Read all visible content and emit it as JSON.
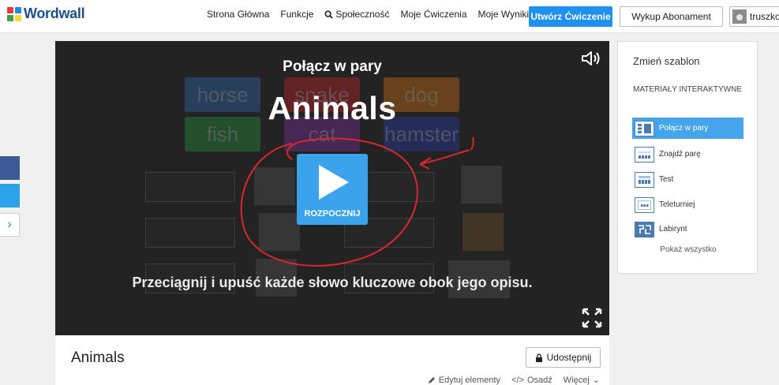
{
  "header": {
    "logo_text": "Wordwall",
    "nav": [
      "Strona Główna",
      "Funkcje",
      "Społeczność",
      "Moje Ćwiczenia",
      "Moje Wyniki"
    ],
    "create_button": "Utwórz Ćwiczenie",
    "subscribe_button": "Wykup Abonament",
    "username": "truszko"
  },
  "game": {
    "template_name": "Połącz w pary",
    "title": "Animals",
    "start_label": "ROZPOCZNIJ",
    "instructions": "Przeciągnij i upuść każde słowo kluczowe obok jego opisu.",
    "words": [
      {
        "text": "horse",
        "color": "#2f75c8"
      },
      {
        "text": "snake",
        "color": "#d9242a"
      },
      {
        "text": "dog",
        "color": "#e87b12"
      },
      {
        "text": "fish",
        "color": "#23a23d"
      },
      {
        "text": "cat",
        "color": "#8b2fb0"
      },
      {
        "text": "hamster",
        "color": "#2b3fb8"
      }
    ]
  },
  "info": {
    "title": "Animals",
    "share_button": "Udostępnij",
    "actions": {
      "edit": "Edytuj elementy",
      "embed": "Osadź",
      "more": "Więcej"
    }
  },
  "template_panel": {
    "title": "Zmień szablon",
    "category": "MATERIAŁY INTERAKTYWNE",
    "items": [
      {
        "label": "Połącz w pary",
        "active": true
      },
      {
        "label": "Znajdź parę",
        "active": false
      },
      {
        "label": "Test",
        "active": false
      },
      {
        "label": "Teleturniej",
        "active": false
      },
      {
        "label": "Labirynt",
        "active": false
      }
    ],
    "show_all": "Pokaż wszystko"
  },
  "colors": {
    "accent": "#1f8ff2",
    "scribble": "#d8262b",
    "logo_squares": [
      "#e53935",
      "#1e88e5",
      "#43a047",
      "#fdd835"
    ]
  }
}
